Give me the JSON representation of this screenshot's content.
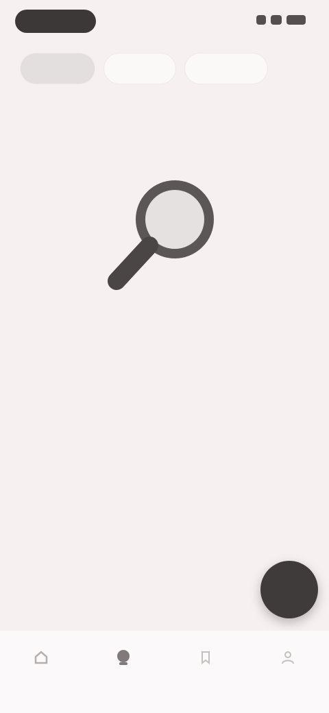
{
  "status_bar": {
    "time": ""
  },
  "filters": {
    "chips": [
      {
        "label": "",
        "active": true
      },
      {
        "label": "",
        "active": false
      },
      {
        "label": "",
        "active": false
      }
    ]
  },
  "empty_state": {
    "icon": "search-icon",
    "title": "",
    "description": ""
  },
  "fab": {
    "icon": "add-icon"
  },
  "bottom_nav": {
    "items": [
      {
        "label": "",
        "icon": "home-icon"
      },
      {
        "label": "",
        "icon": "search-icon"
      },
      {
        "label": "",
        "icon": "bookmark-icon"
      },
      {
        "label": "",
        "icon": "profile-icon"
      }
    ]
  },
  "colors": {
    "background": "#f6f1f0",
    "accent": "#3f3b3b",
    "text_primary": "#444040",
    "text_secondary": "#9a9494"
  }
}
